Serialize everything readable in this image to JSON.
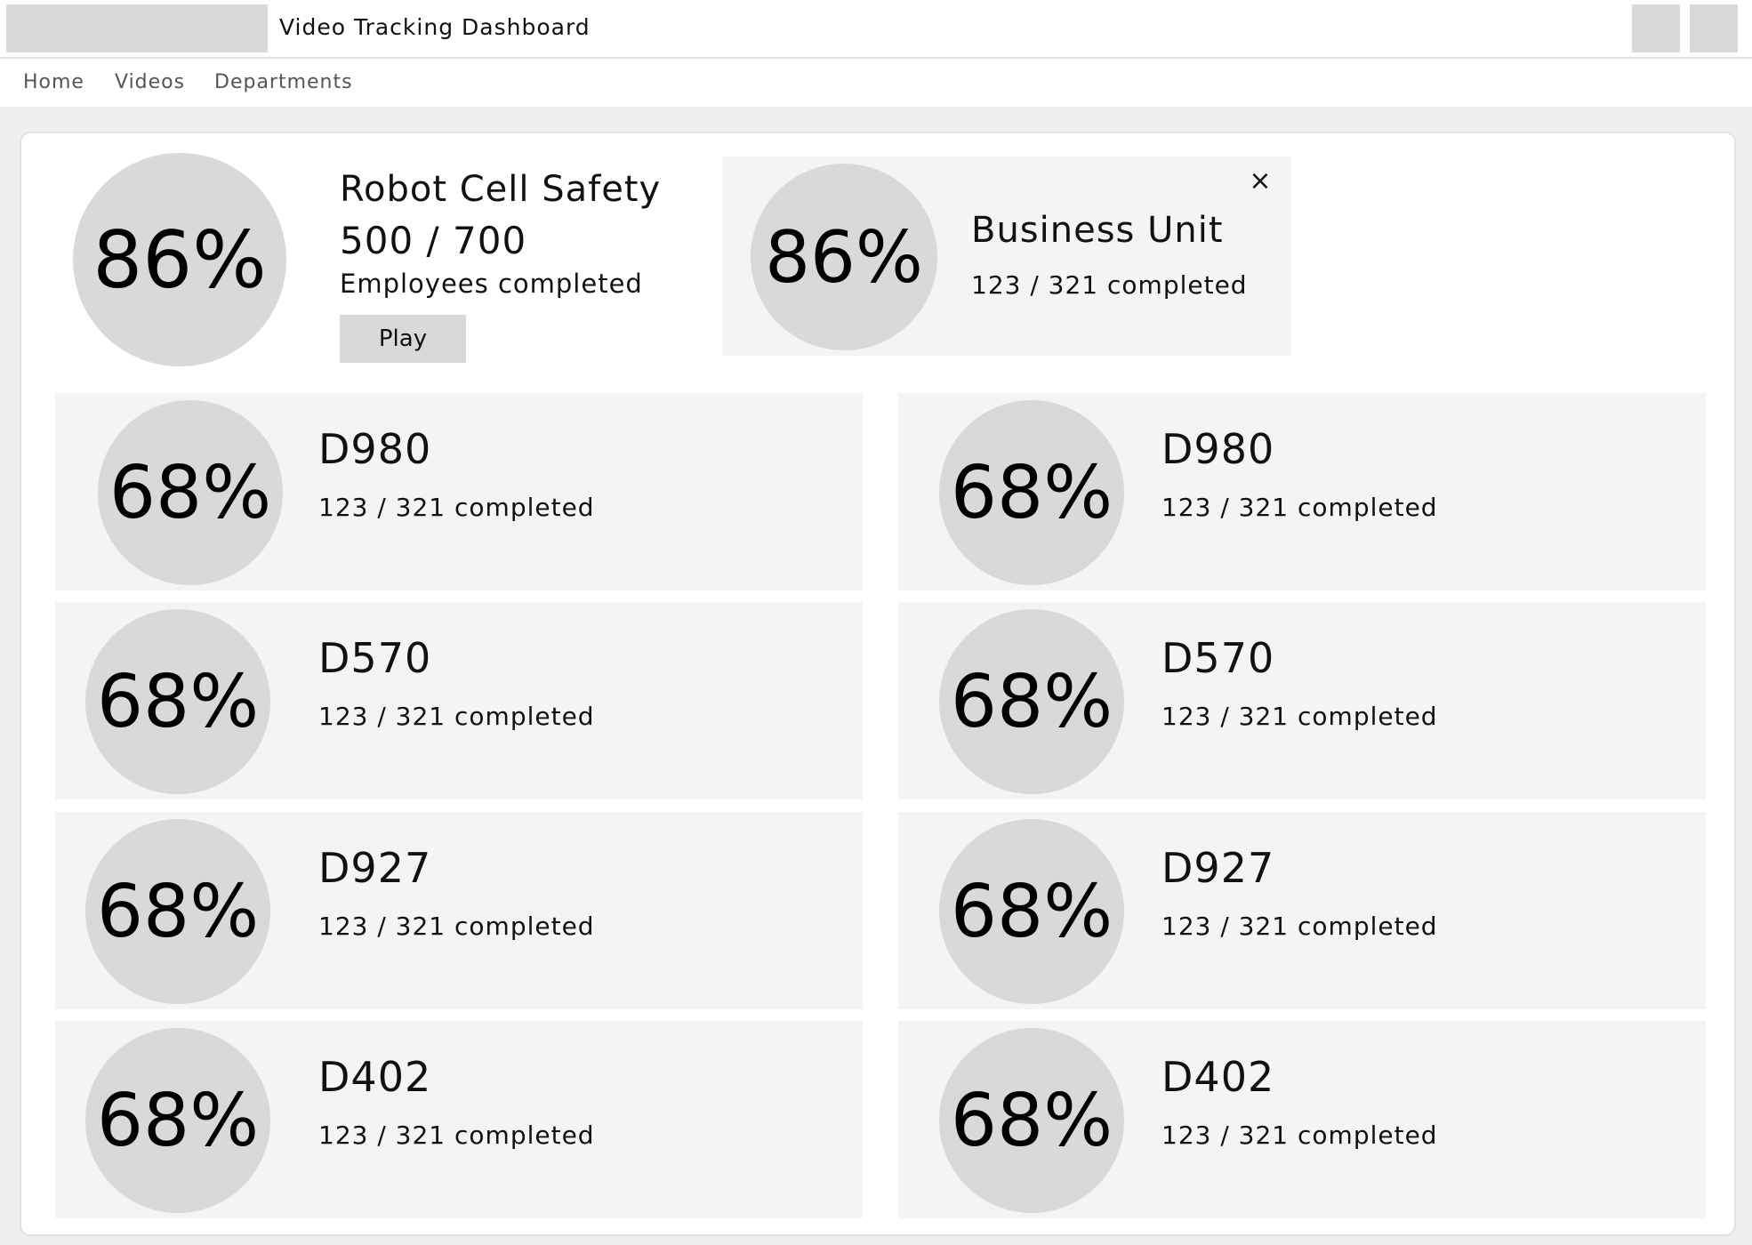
{
  "app": {
    "title": "Video Tracking Dashboard"
  },
  "nav": [
    {
      "label": "Home"
    },
    {
      "label": "Videos"
    },
    {
      "label": "Departments"
    }
  ],
  "featured": {
    "percent": "86%",
    "title": "Robot Cell Safety",
    "count": "500 / 700",
    "subtitle": "Employees completed",
    "play_label": "Play"
  },
  "business_unit": {
    "percent": "86%",
    "name": "Business Unit",
    "stat": "123 / 321 completed",
    "close_glyph": "×"
  },
  "departments": [
    {
      "code": "D980",
      "percent": "68%",
      "stat": "123 / 321 completed"
    },
    {
      "code": "D980",
      "percent": "68%",
      "stat": "123 / 321 completed"
    },
    {
      "code": "D570",
      "percent": "68%",
      "stat": "123 / 321 completed"
    },
    {
      "code": "D570",
      "percent": "68%",
      "stat": "123 / 321 completed"
    },
    {
      "code": "D927",
      "percent": "68%",
      "stat": "123 / 321 completed"
    },
    {
      "code": "D927",
      "percent": "68%",
      "stat": "123 / 321 completed"
    },
    {
      "code": "D402",
      "percent": "68%",
      "stat": "123 / 321 completed"
    },
    {
      "code": "D402",
      "percent": "68%",
      "stat": "123 / 321 completed"
    }
  ]
}
